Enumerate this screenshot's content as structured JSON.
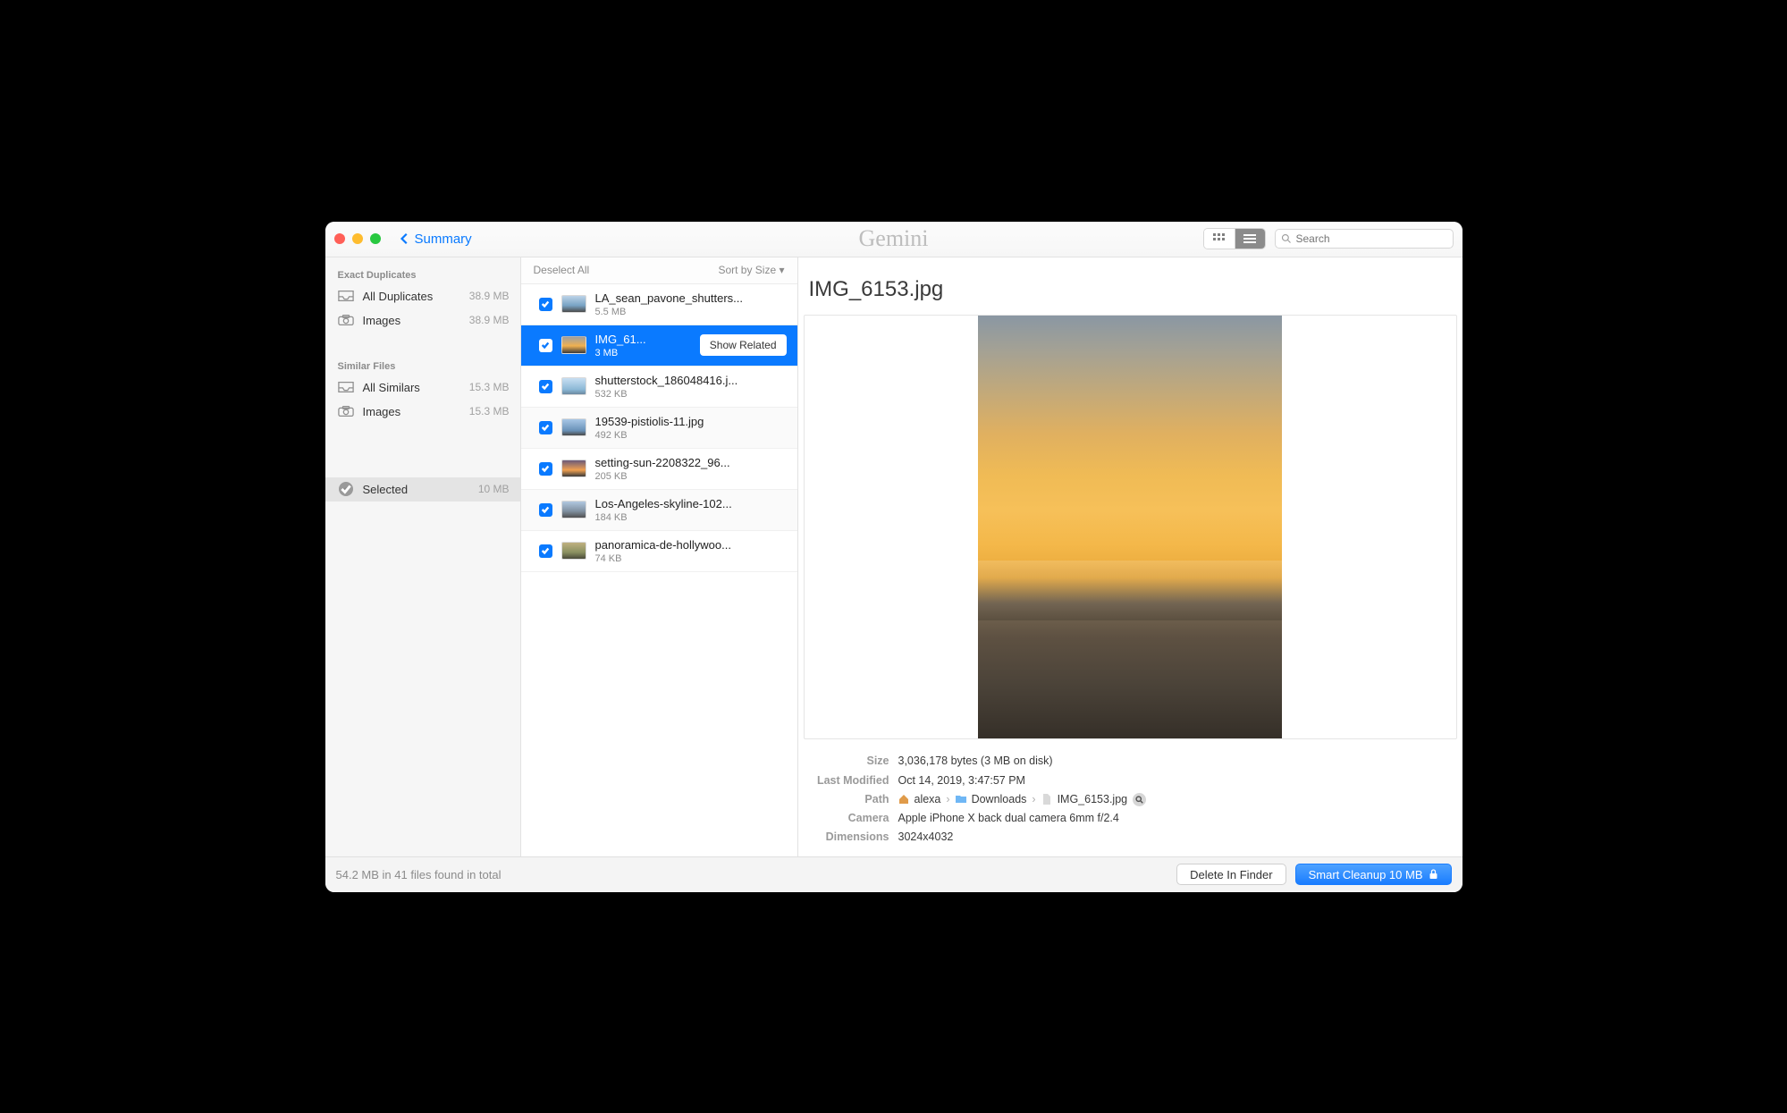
{
  "toolbar": {
    "back_label": "Summary",
    "app_name": "Gemini",
    "search_placeholder": "Search"
  },
  "sidebar": {
    "section1_title": "Exact Duplicates",
    "section2_title": "Similar Files",
    "items_exact": [
      {
        "icon": "tray",
        "label": "All Duplicates",
        "size": "38.9 MB"
      },
      {
        "icon": "camera",
        "label": "Images",
        "size": "38.9 MB"
      }
    ],
    "items_similar": [
      {
        "icon": "tray",
        "label": "All Similars",
        "size": "15.3 MB"
      },
      {
        "icon": "camera",
        "label": "Images",
        "size": "15.3 MB"
      }
    ],
    "selected": {
      "label": "Selected",
      "size": "10 MB"
    }
  },
  "filecol": {
    "deselect": "Deselect All",
    "sort": "Sort by Size ▾",
    "show_related": "Show Related",
    "items": [
      {
        "name": "LA_sean_pavone_shutters...",
        "size": "5.5 MB",
        "thumb": "la"
      },
      {
        "name": "IMG_61...",
        "size": "3 MB",
        "thumb": "sunset",
        "active": true
      },
      {
        "name": "shutterstock_186048416.j...",
        "size": "532 KB",
        "thumb": "sky"
      },
      {
        "name": "19539-pistiolis-11.jpg",
        "size": "492 KB",
        "thumb": "bridge"
      },
      {
        "name": "setting-sun-2208322_96...",
        "size": "205 KB",
        "thumb": "dusk"
      },
      {
        "name": "Los-Angeles-skyline-102...",
        "size": "184 KB",
        "thumb": "city"
      },
      {
        "name": "panoramica-de-hollywoo...",
        "size": "74 KB",
        "thumb": "pano"
      }
    ]
  },
  "preview": {
    "title": "IMG_6153.jpg",
    "meta": {
      "size_k": "Size",
      "size_v": "3,036,178 bytes (3 MB on disk)",
      "lm_k": "Last Modified",
      "lm_v": "Oct 14, 2019, 3:47:57 PM",
      "path_k": "Path",
      "path_parts": [
        "alexa",
        "Downloads",
        "IMG_6153.jpg"
      ],
      "cam_k": "Camera",
      "cam_v": "Apple iPhone X back dual camera 6mm f/2.4",
      "dim_k": "Dimensions",
      "dim_v": "3024x4032"
    }
  },
  "footer": {
    "status": "54.2 MB in 41 files found in total",
    "delete": "Delete In Finder",
    "cleanup": "Smart Cleanup 10 MB"
  },
  "thumb_colors": {
    "la": "linear-gradient(#bcd3e8,#78a3c4 60%,#4b4b4b)",
    "sunset": "linear-gradient(#a0a0a0,#f0b050 55%,#3a3a3a)",
    "sky": "linear-gradient(#c8dff2,#8cb8d6 70%,#6b89a0)",
    "bridge": "linear-gradient(#a8c7e6,#6a92b8 70%,#4a4a4a)",
    "dusk": "linear-gradient(#6b5a7a,#f0a050 60%,#3a3a3a)",
    "city": "linear-gradient(#b0c8e0,#8090a0 60%,#505050)",
    "pano": "linear-gradient(#c0b080,#8a9060 60%,#4a4a3a)"
  }
}
